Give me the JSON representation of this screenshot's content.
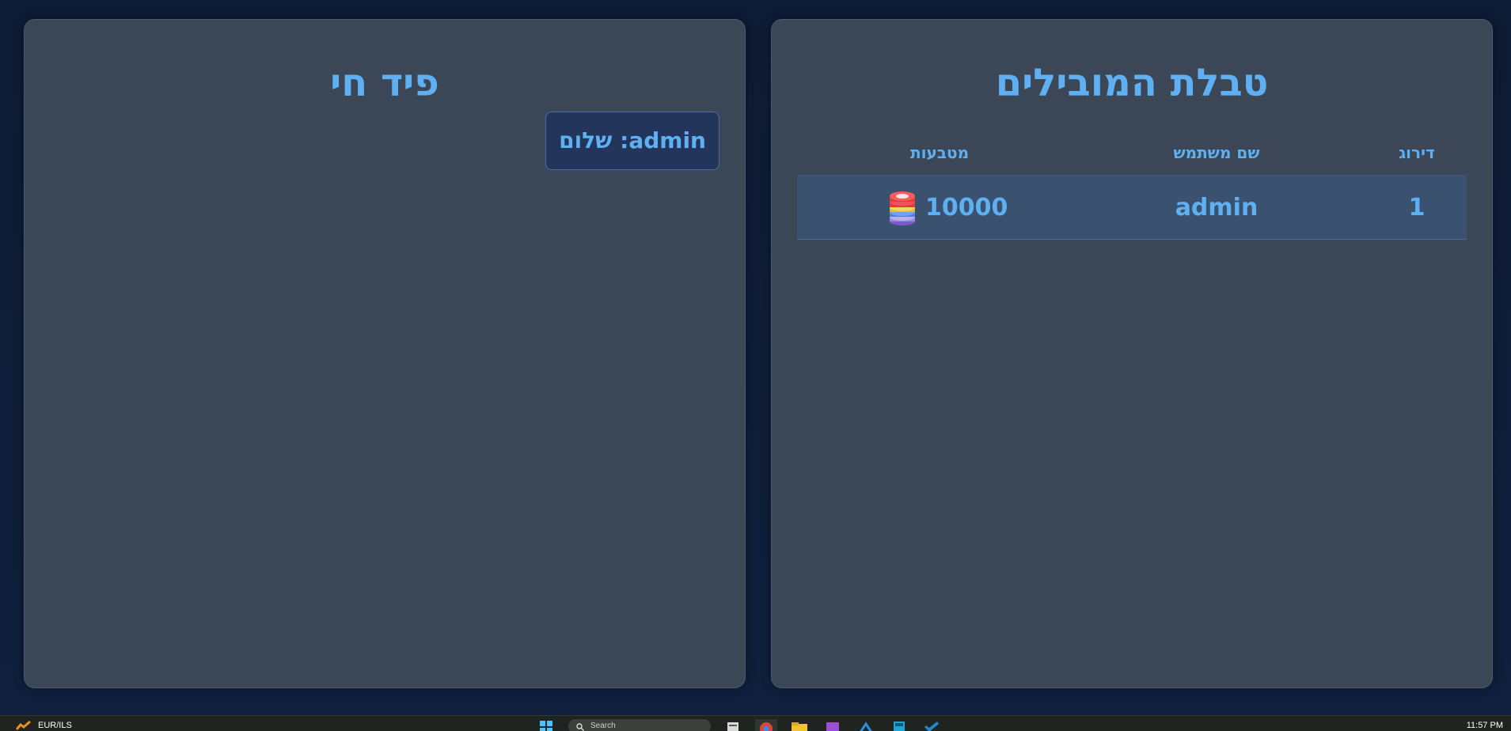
{
  "feed": {
    "title": "פיד חי",
    "items": [
      {
        "text": "admin: שלום"
      }
    ]
  },
  "leaderboard": {
    "title": "טבלת המובילים",
    "columns": {
      "rank": "דירוג",
      "username": "שם משתמש",
      "coins": "מטבעות"
    },
    "rows": [
      {
        "rank": "1",
        "username": "admin",
        "coins": "10000",
        "icon": "poker-chips-icon"
      }
    ]
  },
  "taskbar": {
    "ticker_label": "EUR/ILS",
    "search_placeholder": "Search",
    "clock": "11:57 PM",
    "apps": [
      "start-icon",
      "search-input",
      "widgets-icon",
      "chrome-icon",
      "file-explorer-icon",
      "visual-studio-icon",
      "code-icon",
      "calculator-icon",
      "vscode-icon"
    ]
  },
  "colors": {
    "background": "#0f1c36",
    "panel": "#3b4756",
    "accent": "#5fb0f2",
    "row_highlight": "#3a5170",
    "feed_item": "#23355a"
  }
}
